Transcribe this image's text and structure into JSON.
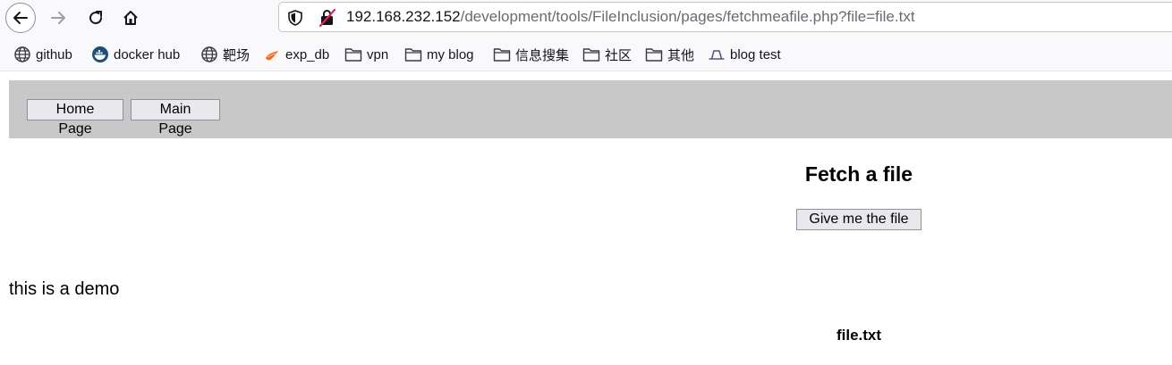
{
  "browser": {
    "url_host": "192.168.232.152",
    "url_path": "/development/tools/FileInclusion/pages/fetchmeafile.php?file=file.txt",
    "icons": {
      "back": "arrow-left-icon",
      "forward": "arrow-right-icon",
      "reload": "reload-icon",
      "home": "home-icon",
      "tracking": "shield-icon",
      "insecure": "insecure-lock-icon"
    }
  },
  "bookmarks": [
    {
      "label": "github",
      "icon": "globe-icon"
    },
    {
      "label": "docker hub",
      "icon": "docker-icon"
    },
    {
      "label": "靶场",
      "icon": "globe-icon"
    },
    {
      "label": "exp_db",
      "icon": "exploitdb-icon"
    },
    {
      "label": "vpn",
      "icon": "folder-icon"
    },
    {
      "label": "my blog",
      "icon": "folder-icon"
    },
    {
      "label": "信息搜集",
      "icon": "folder-icon"
    },
    {
      "label": "社区",
      "icon": "folder-icon"
    },
    {
      "label": "其他",
      "icon": "folder-icon"
    },
    {
      "label": "blog test",
      "icon": "hat-icon"
    }
  ],
  "page": {
    "nav": {
      "home_label": "Home Page",
      "main_label": "Main Page"
    },
    "title": "Fetch a file",
    "button_label": "Give me the file",
    "content": "this is a demo",
    "filename": "file.txt"
  }
}
